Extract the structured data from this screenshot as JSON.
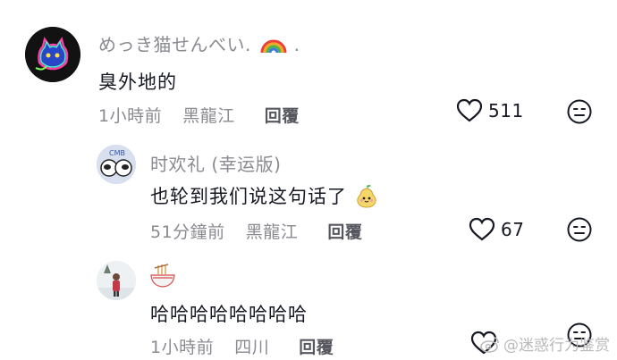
{
  "comments": [
    {
      "username": "めっき猫せんべい.",
      "username_suffix": ".",
      "text": "臭外地的",
      "time": "1小時前",
      "location": "黑龍江",
      "reply_label": "回覆",
      "likes": "511"
    },
    {
      "username": "时欢礼 (幸运版)",
      "text": "也轮到我们说这句话了",
      "time": "51分鐘前",
      "location": "黑龍江",
      "reply_label": "回覆",
      "likes": "67"
    },
    {
      "username": "",
      "text": "哈哈哈哈哈哈哈哈",
      "time": "1小時前",
      "location": "四川",
      "reply_label": "回覆"
    }
  ],
  "watermark": "@迷惑行为鉴赏",
  "colors": {
    "primary_text": "#161823",
    "secondary_text": "#8a8b91",
    "reply_text": "#57585f"
  }
}
